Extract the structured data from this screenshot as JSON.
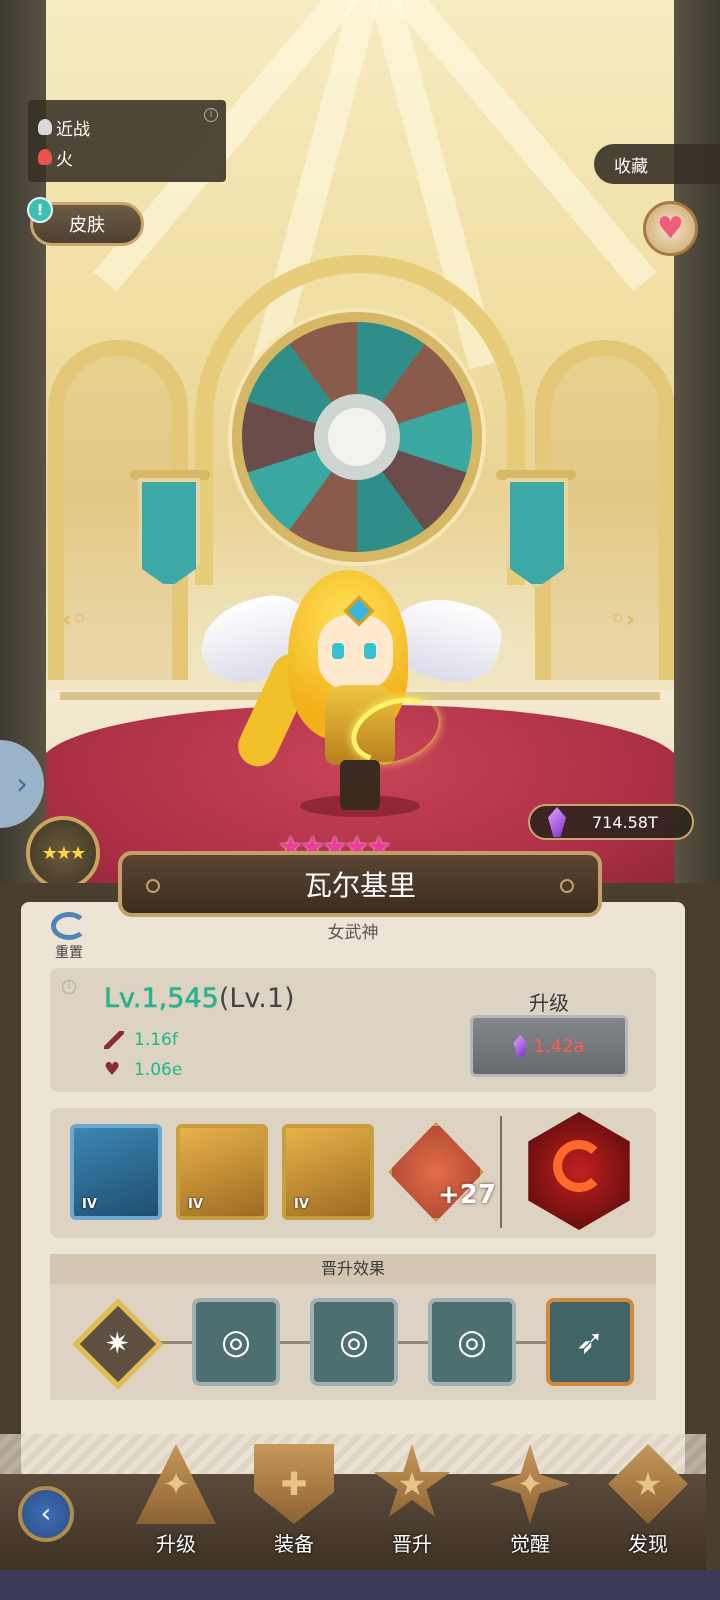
{
  "hero": {
    "types": [
      {
        "label": "近战",
        "icon": "melee-icon"
      },
      {
        "label": "火",
        "icon": "fire-icon"
      }
    ],
    "name": "瓦尔基里",
    "title": "女武神",
    "star_count": 5,
    "rank_stars": 3
  },
  "top": {
    "skin_label": "皮肤",
    "favorite_label": "收藏",
    "crystal_amount": "714.58T"
  },
  "panel": {
    "reset_label": "重置",
    "level": "Lv.1,545",
    "base_level": "(Lv.1)",
    "attack": "1.16f",
    "hp": "1.06e",
    "upgrade_label": "升级",
    "upgrade_cost": "1.42a"
  },
  "equipment": [
    {
      "tier": "IV",
      "icon": "whip-icon",
      "color": "#2d6f9b"
    },
    {
      "tier": "IV",
      "icon": "winged-armor-icon",
      "color": "#c99e3e"
    },
    {
      "tier": "IV",
      "icon": "tiara-icon",
      "color": "#c99e3e"
    }
  ],
  "badge": {
    "count": "+27",
    "icon": "rank-badge-icon"
  },
  "promotion": {
    "header": "晋升效果",
    "nodes": [
      "burst-icon",
      "vortex-icon",
      "vortex-icon",
      "vortex-icon",
      "bow-icon"
    ]
  },
  "nav": [
    {
      "label": "升级",
      "icon": "upgrade-icon"
    },
    {
      "label": "装备",
      "icon": "equipment-icon"
    },
    {
      "label": "晋升",
      "icon": "promotion-icon"
    },
    {
      "label": "觉醒",
      "icon": "awaken-icon"
    },
    {
      "label": "发现",
      "icon": "discover-icon"
    }
  ],
  "colors": {
    "accent_green": "#1fb791",
    "cost_red": "#ff5a5a",
    "pink_star": "#ee3b9d"
  }
}
